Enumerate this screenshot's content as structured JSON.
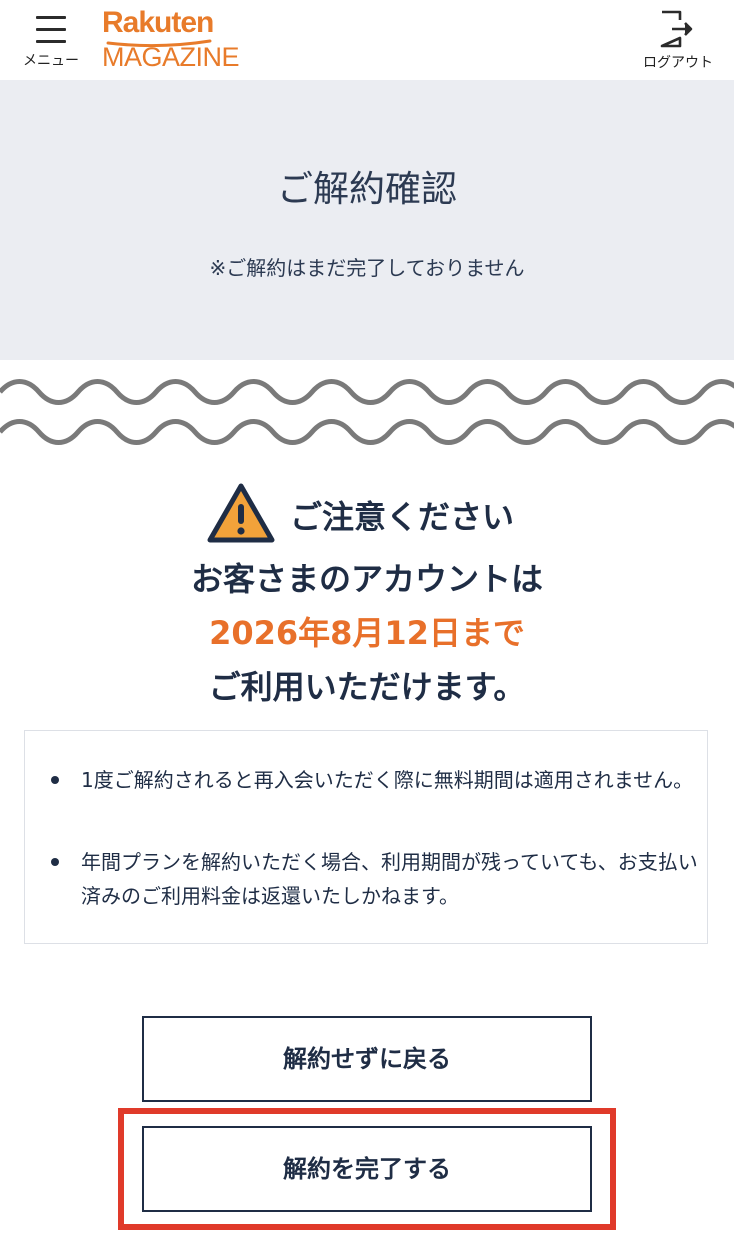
{
  "header": {
    "menu_label": "メニュー",
    "logo_top": "Rakuten",
    "logo_bottom": "MAGAZINE",
    "logout_label": "ログアウト",
    "brand_color": "#e87b2a"
  },
  "hero": {
    "title": "ご解約確認",
    "subtitle": "※ご解約はまだ完了しておりません"
  },
  "notice": {
    "heading": "ご注意ください",
    "line1": "お客さまのアカウントは",
    "line2": "2026年8月12日まで",
    "line3": "ご利用いただけます。",
    "accent_color": "#e8702a"
  },
  "info": {
    "items": [
      "1度ご解約されると再入会いただく際に無料期間は適用されません。",
      "年間プランを解約いただく場合、利用期間が残っていても、お支払い済みのご利用料金は返還いたしかねます。"
    ]
  },
  "buttons": {
    "back_label": "解約せずに戻る",
    "complete_label": "解約を完了する"
  },
  "highlight_color": "#e03a2a"
}
